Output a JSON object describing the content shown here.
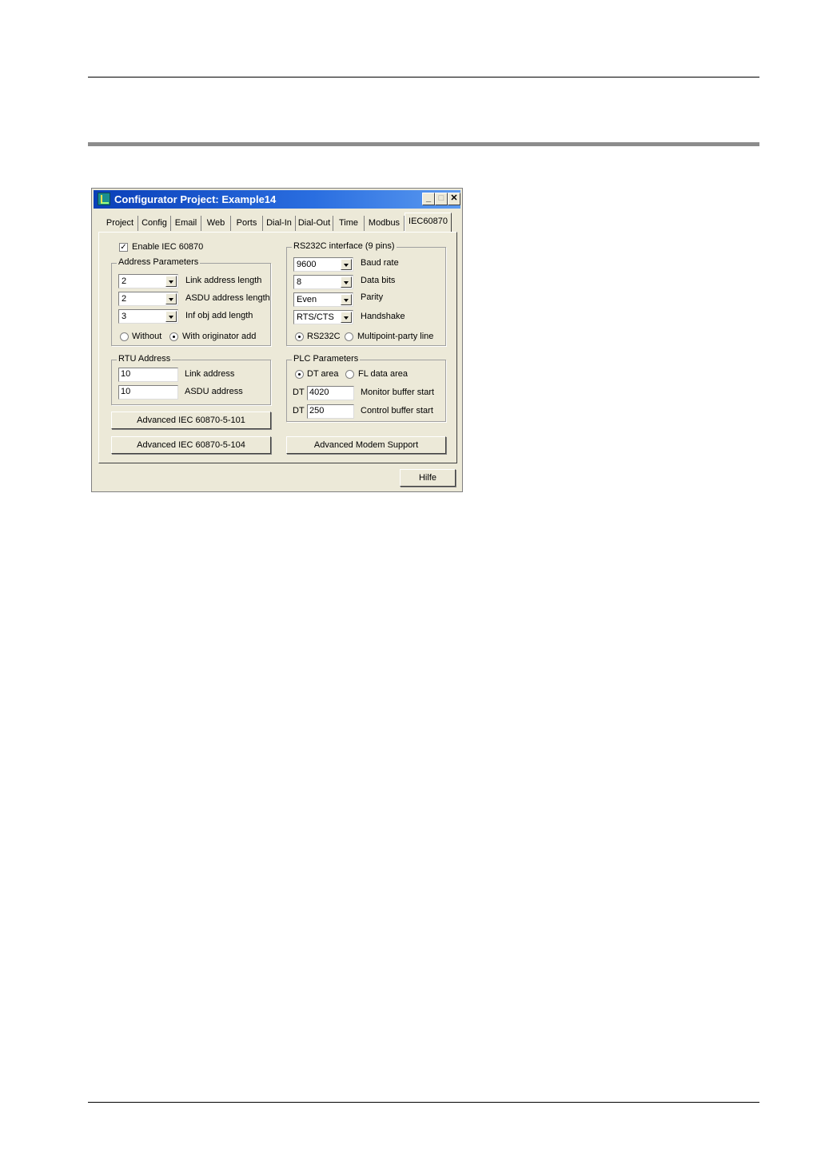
{
  "window": {
    "title": "Configurator Project: Example14",
    "min_glyph": "_",
    "max_glyph": "□",
    "close_glyph": "✕"
  },
  "tabs": [
    "Project",
    "Config",
    "Email",
    "Web",
    "Ports",
    "Dial-In",
    "Dial-Out",
    "Time",
    "Modbus",
    "IEC60870"
  ],
  "active_tab": "IEC60870",
  "enable": {
    "label": "Enable IEC 60870",
    "checked": true,
    "check_glyph": "✓"
  },
  "address_params": {
    "legend": "Address Parameters",
    "rows": [
      {
        "value": "2",
        "label": "Link address length"
      },
      {
        "value": "2",
        "label": "ASDU address length"
      },
      {
        "value": "3",
        "label": "Inf obj add length"
      }
    ],
    "radio_without": "Without",
    "radio_with": "With originator add"
  },
  "rs232": {
    "legend": "RS232C interface (9 pins)",
    "rows": [
      {
        "value": "9600",
        "label": "Baud rate"
      },
      {
        "value": "8",
        "label": "Data bits"
      },
      {
        "value": "Even",
        "label": "Parity"
      },
      {
        "value": "RTS/CTS",
        "label": "Handshake"
      }
    ],
    "radio_rs232": "RS232C",
    "radio_multipoint": "Multipoint-party line"
  },
  "rtu": {
    "legend": "RTU Address",
    "link_value": "10",
    "link_label": "Link address",
    "asdu_value": "10",
    "asdu_label": "ASDU address"
  },
  "plc": {
    "legend": "PLC Parameters",
    "radio_dt": "DT area",
    "radio_fl": "FL data area",
    "prefix": "DT",
    "monitor_value": "4020",
    "monitor_label": "Monitor buffer start",
    "control_value": "250",
    "control_label": "Control buffer start"
  },
  "buttons": {
    "adv101": "Advanced IEC 60870-5-101",
    "adv104": "Advanced IEC 60870-5-104",
    "modem": "Advanced Modem Support",
    "help": "Hilfe"
  }
}
